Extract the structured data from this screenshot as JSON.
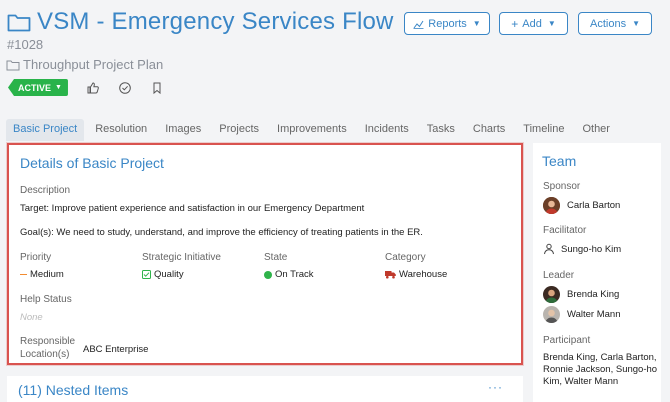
{
  "header": {
    "title": "VSM - Emergency Services Flow",
    "id": "#1028",
    "plan": "Throughput Project Plan",
    "status": "ACTIVE"
  },
  "buttons": {
    "reports": "Reports",
    "add": "Add",
    "actions": "Actions"
  },
  "tabs": [
    "Basic Project",
    "Resolution",
    "Images",
    "Projects",
    "Improvements",
    "Incidents",
    "Tasks",
    "Charts",
    "Timeline",
    "Other"
  ],
  "details": {
    "heading": "Details of Basic Project",
    "description_label": "Description",
    "description_line1": "Target: Improve patient experience and satisfaction in our Emergency Department",
    "description_line2": "Goal(s): We need to study, understand, and improve the efficiency of treating patients in the ER.",
    "priority_label": "Priority",
    "priority_value": "Medium",
    "initiative_label": "Strategic Initiative",
    "initiative_value": "Quality",
    "state_label": "State",
    "state_value": "On Track",
    "category_label": "Category",
    "category_value": "Warehouse",
    "help_label": "Help Status",
    "help_value": "None",
    "location_label_1": "Responsible",
    "location_label_2": "Location(s)",
    "location_value": "ABC Enterprise"
  },
  "nested": {
    "heading": "(11) Nested Items",
    "more": "···"
  },
  "team": {
    "heading": "Team",
    "sponsor_label": "Sponsor",
    "sponsor": "Carla Barton",
    "facilitator_label": "Facilitator",
    "facilitator": "Sungo-ho Kim",
    "leader_label": "Leader",
    "leaders": [
      "Brenda King",
      "Walter Mann"
    ],
    "participant_label": "Participant",
    "participants": "Brenda King, Carla Barton, Ronnie Jackson, Sungo-ho Kim, Walter Mann"
  },
  "colors": {
    "accent": "#3a86c6",
    "active": "#29b34a",
    "highlight_border": "#d9534f",
    "priority_medium": "#f28b30",
    "category_icon": "#c0392b"
  },
  "icons": {
    "title": "folder-icon",
    "plan": "folder-outline-icon",
    "like": "thumbs-up-icon",
    "check": "check-circle-icon",
    "bookmark": "bookmark-icon",
    "reports": "chart-icon",
    "add": "plus-icon",
    "initiative": "check-square-icon",
    "state": "green-dot-icon",
    "category": "truck-icon",
    "facilitator": "user-icon"
  }
}
